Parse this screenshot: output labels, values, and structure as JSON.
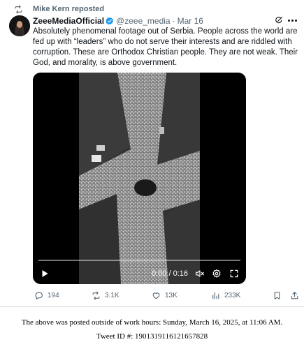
{
  "repost": {
    "label": "Mike Kern reposted",
    "icon": "repost-icon"
  },
  "author": {
    "display_name": "ZeeeMediaOfficial",
    "handle": "@zeee_media",
    "separator": "·",
    "date": "Mar 16",
    "verified_color": "#1d9bf0"
  },
  "post": {
    "text": "Absolutely phenomenal footage out of Serbia. People across the world are fed up with “leaders” who do not serve their interests and are riddled with corruption. These are Orthodox Christian people. They are not weak. Their God, and morality, is above government."
  },
  "video": {
    "time": "0:00 / 0:16",
    "progress": 0
  },
  "actions": {
    "replies": "194",
    "reposts": "3.1K",
    "likes": "13K",
    "views": "233K"
  },
  "footer": {
    "line1": "The above was posted outside of work hours: Sunday, March 16, 2025, at 11:06 AM.",
    "line2": "Tweet ID #: 1901319116121657828"
  },
  "colors": {
    "text_primary": "#0f1419",
    "text_secondary": "#536471",
    "accent": "#1d9bf0",
    "border": "#cfd9de"
  }
}
